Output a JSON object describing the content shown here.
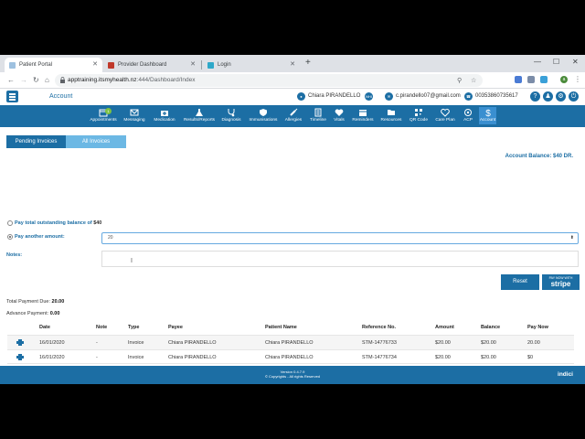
{
  "browser": {
    "tabs": [
      {
        "title": "Patient Portal",
        "active": true
      },
      {
        "title": "Provider Dashboard",
        "active": false
      },
      {
        "title": "Login",
        "active": false
      }
    ],
    "url_host": "apptraining.itsmyhealth.nz",
    "url_path": ":444/Dashboard/Index",
    "profile_initial": "a"
  },
  "header": {
    "title": "Account",
    "user_name": "Chiara PIRANDELLO",
    "nhi_label": "NHI",
    "email": "c.pirandello07@gmail.com",
    "phone": "00353860735617"
  },
  "nav": {
    "items": [
      {
        "label": "Appointments",
        "icon": "calendar-icon",
        "badge": "1"
      },
      {
        "label": "Messaging",
        "icon": "envelope-icon"
      },
      {
        "label": "Medication",
        "icon": "medkit-icon"
      },
      {
        "label": "Results/Reports",
        "icon": "flask-icon"
      },
      {
        "label": "Diagnosis",
        "icon": "stethoscope-icon"
      },
      {
        "label": "Immunisations",
        "icon": "shield-icon"
      },
      {
        "label": "Allergies",
        "icon": "syringe-icon"
      },
      {
        "label": "Timeline",
        "icon": "timeline-icon"
      },
      {
        "label": "Vitals",
        "icon": "heartbeat-icon"
      },
      {
        "label": "Reminders",
        "icon": "calendar-icon"
      },
      {
        "label": "Resources",
        "icon": "folder-icon"
      },
      {
        "label": "QR Code",
        "icon": "qrcode-icon"
      },
      {
        "label": "Care Plan",
        "icon": "heart-icon"
      },
      {
        "label": "ACP",
        "icon": "acp-icon"
      },
      {
        "label": "Account",
        "icon": "dollar-icon",
        "active": true
      }
    ]
  },
  "invoice_tabs": {
    "pending": "Pending Invoices",
    "all": "All Invoices"
  },
  "account_balance": "Account Balance: $40 DR.",
  "payment_options": {
    "total_label": "Pay total outstanding balance of",
    "total_amount": "$40",
    "another_label": "Pay another amount:",
    "amount_value": "20"
  },
  "notes_label": "Notes:",
  "buttons": {
    "reset": "Reset",
    "stripe_top": "PAY NOW WITH",
    "stripe_brand": "stripe"
  },
  "summary": {
    "total_due_label": "Total Payment Due:",
    "total_due_value": "20.00",
    "advance_label": "Advance Payment:",
    "advance_value": "0.00"
  },
  "table": {
    "headers": [
      "Date",
      "Note",
      "Type",
      "Payee",
      "Patient Name",
      "Reference No.",
      "Amount",
      "Balance",
      "Pay Now"
    ],
    "rows": [
      [
        "16/01/2020",
        "-",
        "Invoice",
        "Chiara PIRANDELLO",
        "Chiara PIRANDELLO",
        "STM-14776733",
        "$20.00",
        "$20.00",
        "20.00"
      ],
      [
        "16/01/2020",
        "-",
        "Invoice",
        "Chiara PIRANDELLO",
        "Chiara PIRANDELLO",
        "STM-14776734",
        "$20.00",
        "$20.00",
        "$0"
      ]
    ]
  },
  "footer": {
    "version": "Version 0.4.7.9",
    "copyright": "© Copyrights - All rights Reserved",
    "brand": "indici"
  }
}
